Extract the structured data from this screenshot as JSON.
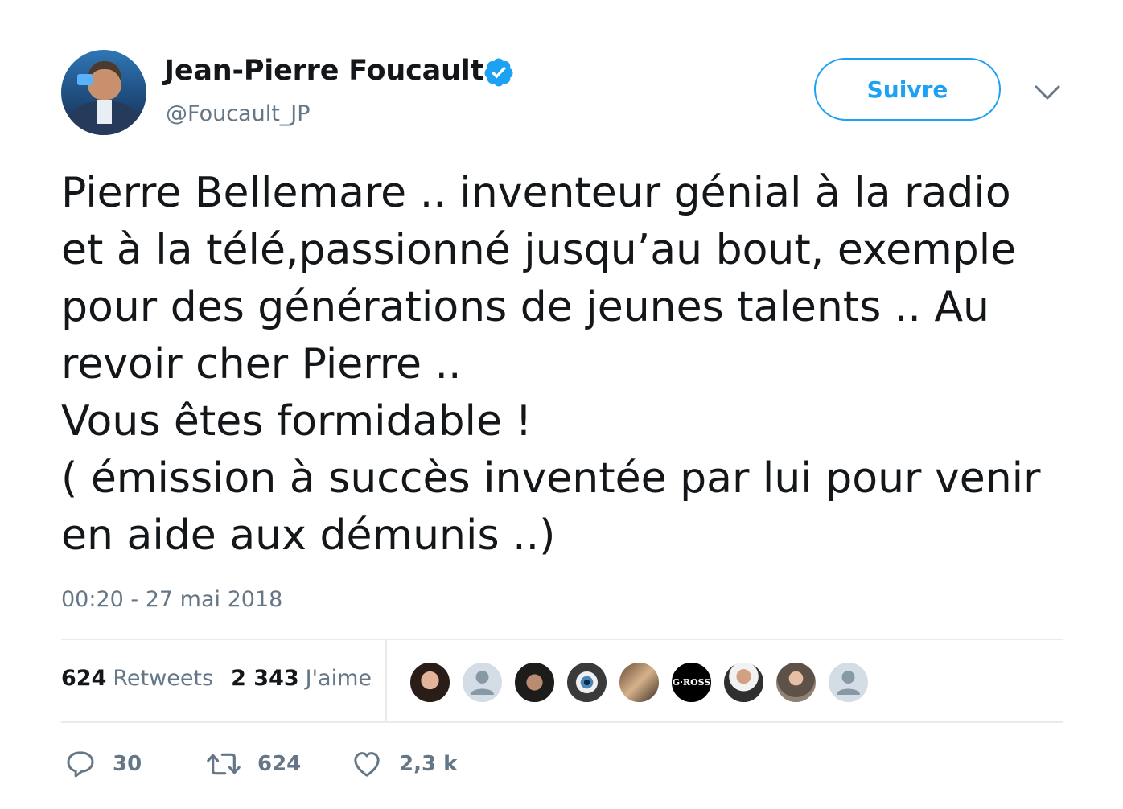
{
  "author": {
    "name": "Jean-Pierre Foucault",
    "handle": "@Foucault_JP",
    "verified": true,
    "follow_label": "Suivre"
  },
  "tweet": {
    "text": "Pierre Bellemare .. inventeur génial à la radio\net à la télé,passionné jusqu’au bout, exemple\npour des générations de jeunes talents .. Au\nrevoir cher Pierre ..\nVous êtes formidable !\n( émission à succès inventée par lui pour venir\nen aide aux démunis ..)",
    "timestamp": "00:20 - 27 mai 2018"
  },
  "stats": {
    "retweets_count": "624",
    "retweets_label": "Retweets",
    "likes_count": "2 343",
    "likes_label": "J'aime"
  },
  "likers": [
    {
      "name": "liker-1"
    },
    {
      "name": "liker-2-default"
    },
    {
      "name": "liker-3"
    },
    {
      "name": "liker-4-eye"
    },
    {
      "name": "liker-5"
    },
    {
      "name": "liker-6-gross",
      "text": "G·ROSS"
    },
    {
      "name": "liker-7"
    },
    {
      "name": "liker-8"
    },
    {
      "name": "liker-9-default"
    }
  ],
  "actions": {
    "reply_count": "30",
    "retweet_count": "624",
    "like_count": "2,3 k"
  },
  "colors": {
    "accent": "#1da1f2",
    "text": "#14171a",
    "muted": "#657786",
    "divider": "#e6ecf0"
  },
  "icons": [
    "verified-badge-icon",
    "chevron-down-icon",
    "reply-icon",
    "retweet-icon",
    "heart-icon",
    "default-avatar-icon"
  ]
}
